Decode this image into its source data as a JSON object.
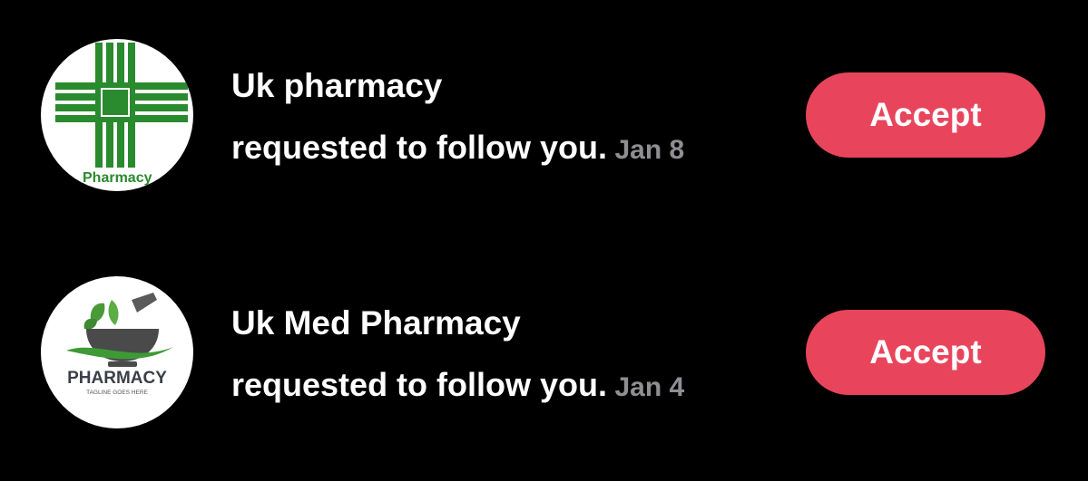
{
  "colors": {
    "background": "#000000",
    "accent": "#e8455c",
    "primary_text": "#ffffff",
    "secondary_text": "#8e8e93",
    "pharmacy_green": "#2a8a2e"
  },
  "requests": [
    {
      "name": "Uk pharmacy",
      "message": "requested to follow you.",
      "date": "Jan 8",
      "accept_label": "Accept",
      "avatar": {
        "icon": "green-cross-logo",
        "text": "Pharmacy"
      }
    },
    {
      "name": "Uk Med Pharmacy",
      "message": "requested to follow you.",
      "date": "Jan 4",
      "accept_label": "Accept",
      "avatar": {
        "icon": "mortar-pestle-logo",
        "text": "PHARMACY",
        "tagline": "TAGLINE GOES HERE"
      }
    }
  ]
}
